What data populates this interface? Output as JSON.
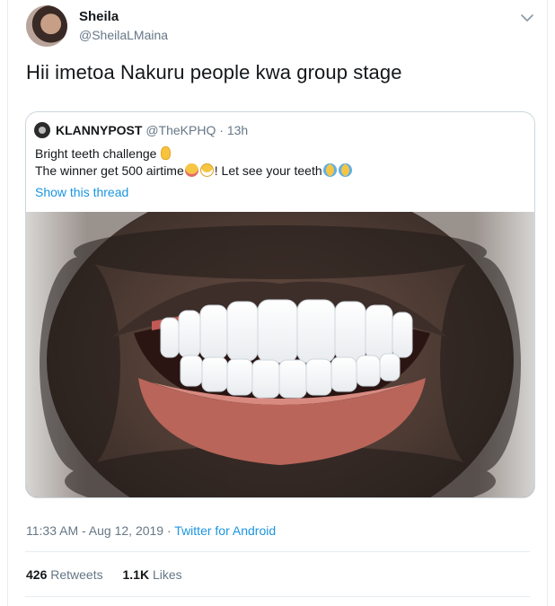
{
  "author": {
    "name": "Sheila",
    "handle": "@SheilaLMaina"
  },
  "tweet": {
    "text": "Hii imetoa Nakuru people kwa group stage"
  },
  "quoted_tweet": {
    "name": "KLANNYPOST",
    "handle": "@TheKPHQ",
    "separator": " · ",
    "age": "13h",
    "line1_text": "Bright teeth challenge",
    "line1_emoji": "ok-hand-emoji",
    "line2_part1": "The winner get 500 airtime",
    "line2_emoji1": "face-savoring-food-emoji",
    "line2_emoji2": "grinning-face-emoji",
    "line2_part2": "! Let see your teeth",
    "line2_emoji3": "tears-of-joy-emoji",
    "show_thread": "Show this thread",
    "photo": "close-up photo of a smiling mouth with bright white teeth"
  },
  "meta": {
    "time": "11:33 AM",
    "separator1": " - ",
    "date": "Aug 12, 2019",
    "separator2": " · ",
    "client": "Twitter for Android"
  },
  "stats": {
    "retweets_count": "426",
    "retweets_label": "Retweets",
    "likes_count": "1.1K",
    "likes_label": "Likes"
  },
  "colors": {
    "link": "#1b95e0",
    "secondary_text": "#657786",
    "border": "#ccd6dd"
  }
}
